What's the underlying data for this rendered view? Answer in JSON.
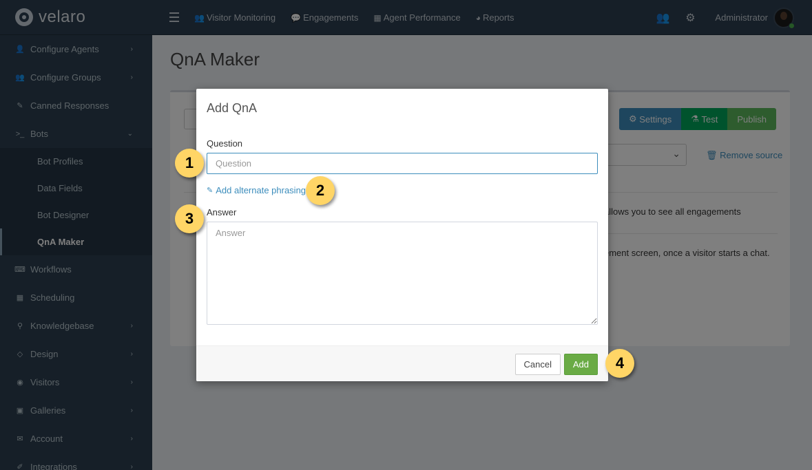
{
  "brand": {
    "name": "velaro"
  },
  "nav": {
    "items": [
      {
        "label": "Visitor Monitoring",
        "icon": "users-icon"
      },
      {
        "label": "Engagements",
        "icon": "chat-icon"
      },
      {
        "label": "Agent Performance",
        "icon": "grid-icon"
      },
      {
        "label": "Reports",
        "icon": "pie-chart-icon"
      }
    ],
    "admin_name": "Administrator",
    "status_color": "#4cae4c"
  },
  "sidebar": {
    "items": [
      {
        "label": "Configure Agents",
        "icon": "user-icon",
        "has_chevron": true
      },
      {
        "label": "Configure Groups",
        "icon": "users-icon",
        "has_chevron": true
      },
      {
        "label": "Canned Responses",
        "icon": "edit-icon",
        "has_chevron": false
      },
      {
        "label": "Bots",
        "icon": "terminal-icon",
        "has_chevron": true,
        "expanded": true
      }
    ],
    "bots_sub": [
      {
        "label": "Bot Profiles"
      },
      {
        "label": "Data Fields"
      },
      {
        "label": "Bot Designer"
      },
      {
        "label": "QnA Maker",
        "active": true
      }
    ],
    "items_after": [
      {
        "label": "Workflows",
        "icon": "keyboard-icon",
        "has_chevron": false
      },
      {
        "label": "Scheduling",
        "icon": "calendar-icon",
        "has_chevron": false
      },
      {
        "label": "Knowledgebase",
        "icon": "map-marker-icon",
        "has_chevron": true
      },
      {
        "label": "Design",
        "icon": "diamond-icon",
        "has_chevron": true
      },
      {
        "label": "Visitors",
        "icon": "eye-icon",
        "has_chevron": true
      },
      {
        "label": "Galleries",
        "icon": "image-icon",
        "has_chevron": true
      },
      {
        "label": "Account",
        "icon": "envelope-icon",
        "has_chevron": true
      },
      {
        "label": "Integrations",
        "icon": "plug-icon",
        "has_chevron": true
      }
    ]
  },
  "page": {
    "title": "QnA Maker",
    "settings_label": "Settings",
    "test_label": "Test",
    "publish_label": "Publish",
    "remove_source_label": "Remove source",
    "row1_tail": "allows you to see all engagements",
    "row2_tail": "ement screen, once a visitor starts a chat."
  },
  "modal": {
    "title": "Add QnA",
    "question_label": "Question",
    "question_placeholder": "Question",
    "alt_phrasing_label": "Add alternate phrasing",
    "answer_label": "Answer",
    "answer_placeholder": "Answer",
    "cancel_label": "Cancel",
    "add_label": "Add"
  },
  "callouts": [
    "1",
    "2",
    "3",
    "4"
  ],
  "colors": {
    "navbar": "#2c3e50",
    "link": "#3c8dbc",
    "add_button": "#6aab45",
    "callout": "#ffd566"
  }
}
